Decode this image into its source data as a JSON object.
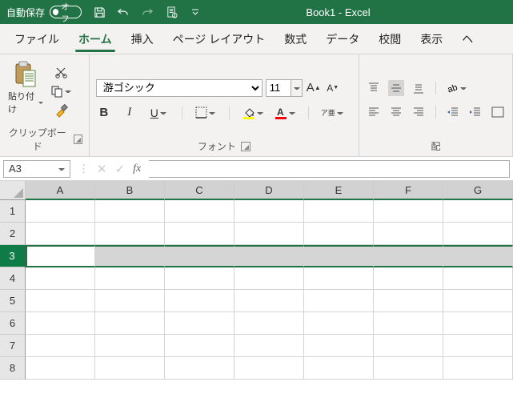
{
  "titlebar": {
    "autosave_label": "自動保存",
    "autosave_state": "オフ",
    "doc_title": "Book1  -  Excel"
  },
  "tabs": {
    "file": "ファイル",
    "home": "ホーム",
    "insert": "挿入",
    "pagelayout": "ページ レイアウト",
    "formulas": "数式",
    "data": "データ",
    "review": "校閲",
    "view": "表示",
    "help": "ヘ"
  },
  "ribbon": {
    "clipboard": {
      "paste": "貼り付け",
      "group": "クリップボード"
    },
    "font": {
      "name": "游ゴシック",
      "size": "11",
      "group": "フォント",
      "phonetic": "ア亜"
    },
    "align": {
      "group": "配"
    }
  },
  "fbar": {
    "namebox": "A3",
    "formula": ""
  },
  "grid": {
    "cols": [
      "A",
      "B",
      "C",
      "D",
      "E",
      "F",
      "G"
    ],
    "rows": [
      "1",
      "2",
      "3",
      "4",
      "5",
      "6",
      "7",
      "8"
    ],
    "selected_row": "3",
    "active_cell": "A3"
  }
}
